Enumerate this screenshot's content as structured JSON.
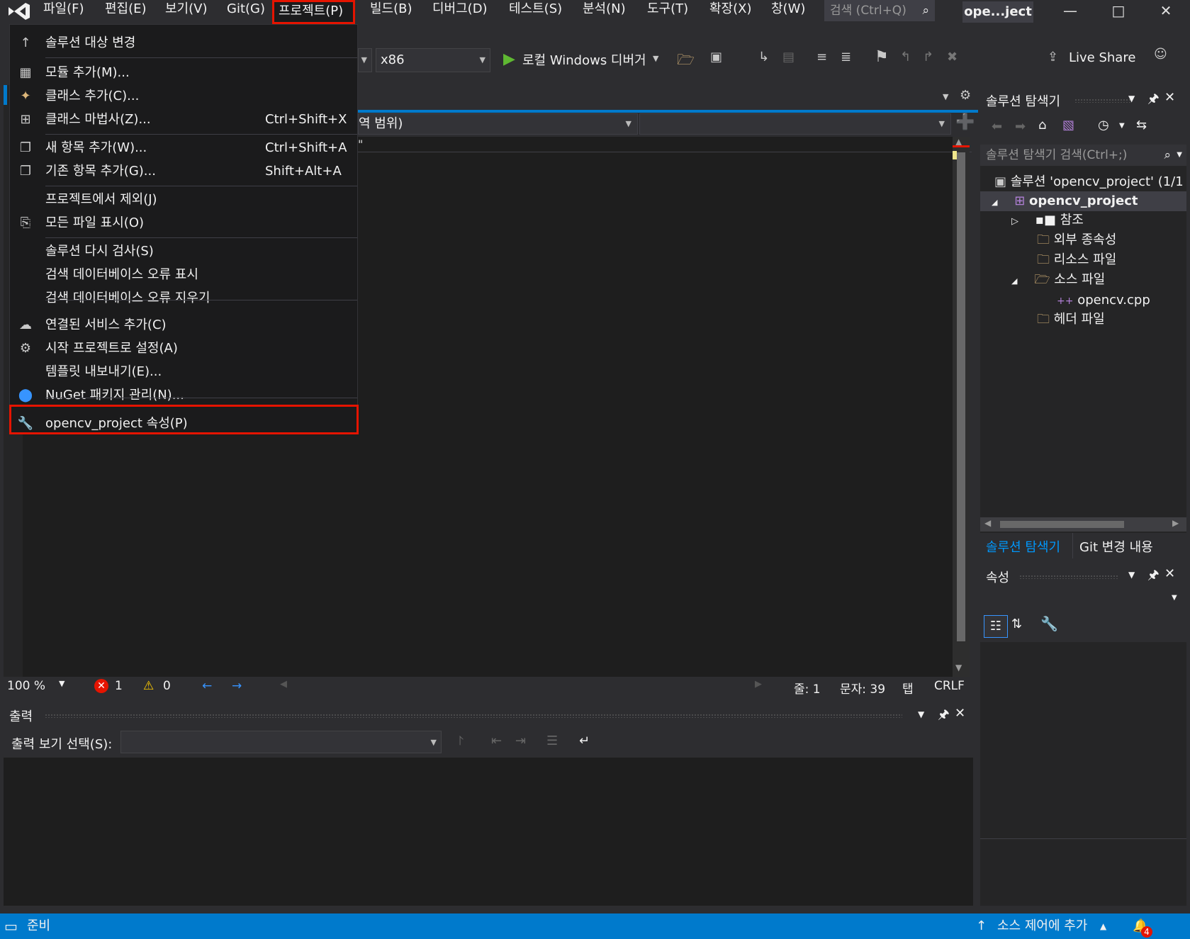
{
  "menubar": {
    "items": [
      "파일(F)",
      "편집(E)",
      "보기(V)",
      "Git(G)",
      "프로젝트(P)",
      "빌드(B)",
      "디버그(D)",
      "테스트(S)",
      "분석(N)",
      "도구(T)",
      "확장(X)",
      "창(W)"
    ],
    "search_placeholder": "검색 (Ctrl+Q)",
    "project_title": "ope...ject"
  },
  "toolbar": {
    "platform": "x86",
    "run_label": "로컬 Windows 디버거",
    "live_share": "Live Share"
  },
  "editor": {
    "nav_scope": "역 범위)",
    "code_fragment": "\"",
    "status": {
      "zoom": "100 %",
      "errors": "1",
      "warnings": "0",
      "line": "줄: 1",
      "col": "문자: 39",
      "tab": "탭",
      "eol": "CRLF"
    }
  },
  "project_menu": {
    "items": [
      {
        "label": "솔루션 대상 변경",
        "shortcut": "",
        "icon": "arrow-up-icon"
      },
      {
        "label": "모듈 추가(M)...",
        "shortcut": "",
        "icon": "module-icon"
      },
      {
        "label": "클래스 추가(C)...",
        "shortcut": "",
        "icon": "class-icon"
      },
      {
        "label": "클래스 마법사(Z)...",
        "shortcut": "Ctrl+Shift+X",
        "icon": "class-wizard-icon"
      },
      {
        "label": "새 항목 추가(W)...",
        "shortcut": "Ctrl+Shift+A",
        "icon": "new-item-icon"
      },
      {
        "label": "기존 항목 추가(G)...",
        "shortcut": "Shift+Alt+A",
        "icon": "existing-item-icon"
      },
      {
        "label": "프로젝트에서 제외(J)",
        "shortcut": "",
        "icon": ""
      },
      {
        "label": "모든 파일 표시(O)",
        "shortcut": "",
        "icon": "show-all-files-icon"
      },
      {
        "label": "솔루션 다시 검사(S)",
        "shortcut": "",
        "icon": ""
      },
      {
        "label": "검색 데이터베이스 오류 표시",
        "shortcut": "",
        "icon": ""
      },
      {
        "label": "검색 데이터베이스 오류 지우기",
        "shortcut": "",
        "icon": ""
      },
      {
        "label": "연결된 서비스 추가(C)",
        "shortcut": "",
        "icon": "connected-service-icon"
      },
      {
        "label": "시작 프로젝트로 설정(A)",
        "shortcut": "",
        "icon": "gear-icon"
      },
      {
        "label": "템플릿 내보내기(E)...",
        "shortcut": "",
        "icon": ""
      },
      {
        "label": "NuGet 패키지 관리(N)...",
        "shortcut": "",
        "icon": "nuget-icon"
      },
      {
        "label": "opencv_project 속성(P)",
        "shortcut": "",
        "icon": "wrench-icon"
      }
    ]
  },
  "solution_explorer": {
    "title": "솔루션 탐색기",
    "search_placeholder": "솔루션 탐색기 검색(Ctrl+;)",
    "tree": [
      {
        "label": "솔루션 'opencv_project' (1/1 ",
        "level": 0
      },
      {
        "label": "opencv_project",
        "level": 1
      },
      {
        "label": "참조",
        "level": 2
      },
      {
        "label": "외부 종속성",
        "level": 2
      },
      {
        "label": "리소스 파일",
        "level": 2
      },
      {
        "label": "소스 파일",
        "level": 2
      },
      {
        "label": "opencv.cpp",
        "level": 3
      },
      {
        "label": "헤더 파일",
        "level": 2
      }
    ],
    "tabs": [
      "솔루션 탐색기",
      "Git 변경 내용"
    ]
  },
  "properties": {
    "title": "속성"
  },
  "output": {
    "title": "출력",
    "show_from_label": "출력 보기 선택(S):"
  },
  "statusbar": {
    "ready": "준비",
    "source_control": "소스 제어에 추가",
    "notifications": "4"
  },
  "colors": {
    "accent": "#007acc",
    "highlight_box": "#e51400",
    "background": "#2d2d30"
  }
}
